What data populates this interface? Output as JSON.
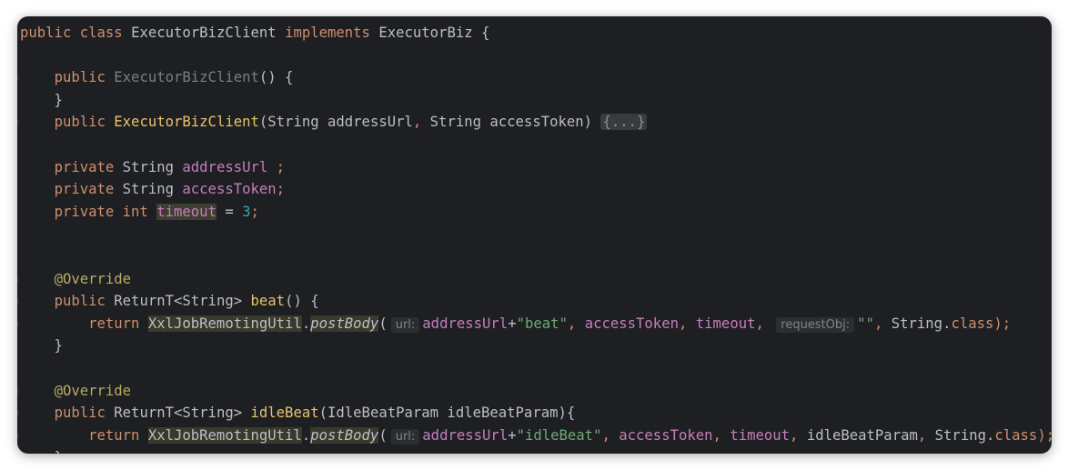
{
  "editor": {
    "lines": [
      [
        {
          "t": "public ",
          "c": "kw"
        },
        {
          "t": "class ",
          "c": "kw"
        },
        {
          "t": "ExecutorBizClient ",
          "c": "cls"
        },
        {
          "t": "implements ",
          "c": "kw"
        },
        {
          "t": "ExecutorBiz {",
          "c": "cls"
        }
      ],
      [],
      [
        {
          "t": "    "
        },
        {
          "t": "public ",
          "c": "kw"
        },
        {
          "t": "ExecutorBizClient",
          "c": "dim"
        },
        {
          "t": "() {",
          "c": "cls"
        }
      ],
      [
        {
          "t": "    }",
          "c": "cls"
        }
      ],
      [
        {
          "t": "    "
        },
        {
          "t": "public ",
          "c": "kw"
        },
        {
          "t": "ExecutorBizClient",
          "c": "decl"
        },
        {
          "t": "(String addressUrl",
          "c": "cls"
        },
        {
          "t": ", ",
          "c": "kw"
        },
        {
          "t": "String accessToken) ",
          "c": "cls"
        },
        {
          "t": "{...}",
          "c": "fold"
        }
      ],
      [],
      [
        {
          "t": "    "
        },
        {
          "t": "private ",
          "c": "kw"
        },
        {
          "t": "String ",
          "c": "cls"
        },
        {
          "t": "addressUrl ",
          "c": "fld"
        },
        {
          "t": ";",
          "c": "kw"
        }
      ],
      [
        {
          "t": "    "
        },
        {
          "t": "private ",
          "c": "kw"
        },
        {
          "t": "String ",
          "c": "cls"
        },
        {
          "t": "accessToken",
          "c": "fld"
        },
        {
          "t": ";",
          "c": "kw"
        }
      ],
      [
        {
          "t": "    "
        },
        {
          "t": "private ",
          "c": "kw"
        },
        {
          "t": "int ",
          "c": "kw"
        },
        {
          "t": "timeout",
          "c": "fld hl"
        },
        {
          "t": " = ",
          "c": "cls"
        },
        {
          "t": "3",
          "c": "num"
        },
        {
          "t": ";",
          "c": "kw"
        }
      ],
      [],
      [],
      [
        {
          "t": "    "
        },
        {
          "t": "@Override",
          "c": "ann"
        }
      ],
      [
        {
          "t": "    "
        },
        {
          "t": "public ",
          "c": "kw"
        },
        {
          "t": "ReturnT<String> ",
          "c": "cls"
        },
        {
          "t": "beat",
          "c": "decl"
        },
        {
          "t": "() {",
          "c": "cls"
        }
      ],
      [
        {
          "t": "        "
        },
        {
          "t": "return ",
          "c": "kw"
        },
        {
          "t": "XxlJobRemotingUtil",
          "c": "cls hl-util"
        },
        {
          "t": ".",
          "c": "cls"
        },
        {
          "t": "postBody",
          "c": "cls italic hl-util"
        },
        {
          "t": "(",
          "c": "cls"
        },
        {
          "t": "url:",
          "c": "hint"
        },
        {
          "t": "addressUrl",
          "c": "fld"
        },
        {
          "t": "+",
          "c": "cls"
        },
        {
          "t": "\"beat\"",
          "c": "str"
        },
        {
          "t": ", ",
          "c": "kw"
        },
        {
          "t": "accessToken",
          "c": "fld"
        },
        {
          "t": ", ",
          "c": "kw"
        },
        {
          "t": "timeout",
          "c": "fld"
        },
        {
          "t": ", ",
          "c": "kw"
        },
        {
          "t": "requestObj:",
          "c": "hint"
        },
        {
          "t": "\"\"",
          "c": "str"
        },
        {
          "t": ", ",
          "c": "kw"
        },
        {
          "t": "String.",
          "c": "cls"
        },
        {
          "t": "class",
          "c": "kw"
        },
        {
          "t": ");",
          "c": "kw"
        }
      ],
      [
        {
          "t": "    }",
          "c": "cls"
        }
      ],
      [],
      [
        {
          "t": "    "
        },
        {
          "t": "@Override",
          "c": "ann"
        }
      ],
      [
        {
          "t": "    "
        },
        {
          "t": "public ",
          "c": "kw"
        },
        {
          "t": "ReturnT<String> ",
          "c": "cls"
        },
        {
          "t": "idleBeat",
          "c": "decl"
        },
        {
          "t": "(IdleBeatParam idleBeatParam){",
          "c": "cls"
        }
      ],
      [
        {
          "t": "        "
        },
        {
          "t": "return ",
          "c": "kw"
        },
        {
          "t": "XxlJobRemotingUtil",
          "c": "cls hl-util"
        },
        {
          "t": ".",
          "c": "cls"
        },
        {
          "t": "postBody",
          "c": "cls italic hl-util"
        },
        {
          "t": "(",
          "c": "cls"
        },
        {
          "t": "url:",
          "c": "hint"
        },
        {
          "t": "addressUrl",
          "c": "fld"
        },
        {
          "t": "+",
          "c": "cls"
        },
        {
          "t": "\"idleBeat\"",
          "c": "str"
        },
        {
          "t": ", ",
          "c": "kw"
        },
        {
          "t": "accessToken",
          "c": "fld"
        },
        {
          "t": ", ",
          "c": "kw"
        },
        {
          "t": "timeout",
          "c": "fld"
        },
        {
          "t": ", ",
          "c": "kw"
        },
        {
          "t": "idleBeatParam",
          "c": "cls"
        },
        {
          "t": ", ",
          "c": "kw"
        },
        {
          "t": "String.",
          "c": "cls"
        },
        {
          "t": "class",
          "c": "kw"
        },
        {
          "t": ");",
          "c": "kw"
        }
      ],
      [
        {
          "t": "    }",
          "c": "cls"
        }
      ]
    ]
  }
}
